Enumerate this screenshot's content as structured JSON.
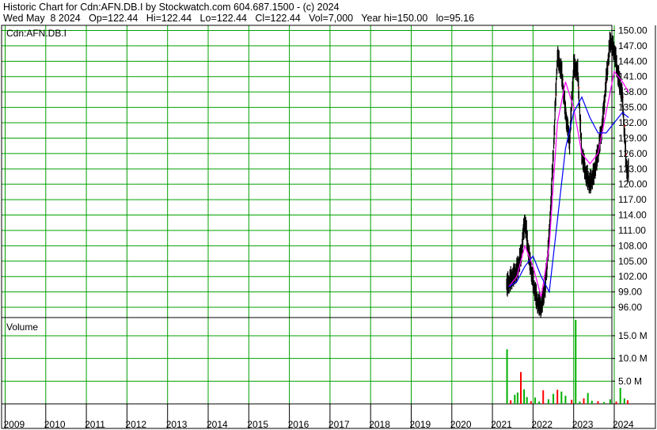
{
  "header": {
    "line1": "Historic Chart for Cdn:AFN.DB.I by Stockwatch.com 604.687.1500 - (c) 2024",
    "line2": "Wed May  8 2024   Op=122.44   Hi=122.44   Lo=122.44   Cl=122.44   Vol=7,000   Year hi=150.00   lo=95.16"
  },
  "price_panel": {
    "symbol_label": "Cdn:AFN.DB.I"
  },
  "volume_panel": {
    "label": "Volume"
  },
  "colors": {
    "grid": "#00a000",
    "price_bar": "#000000",
    "down_mark": "#ff0000",
    "ma_short": "#ff00ff",
    "ma_long": "#0000ff",
    "vol_up": "#00b000",
    "vol_down": "#ff0000"
  },
  "chart_data": [
    {
      "type": "line",
      "title": "Cdn:AFN.DB.I",
      "x_ticks": [
        "2009",
        "2010",
        "2011",
        "2012",
        "2013",
        "2014",
        "2015",
        "2016",
        "2017",
        "2018",
        "2019",
        "2020",
        "2021",
        "2022",
        "2023",
        "2024"
      ],
      "y_ticks": [
        "96.00",
        "99.00",
        "102.00",
        "105.00",
        "108.00",
        "111.00",
        "114.00",
        "117.00",
        "120.00",
        "123.00",
        "126.00",
        "129.00",
        "132.00",
        "135.00",
        "138.00",
        "141.00",
        "144.00",
        "147.00",
        "150.00"
      ],
      "ylim": [
        94,
        151
      ],
      "grid": true,
      "series": [
        {
          "name": "",
          "x": [
            2021.35,
            2021.5,
            2021.6,
            2021.7,
            2021.8,
            2021.9,
            2022.0,
            2022.1,
            2022.2,
            2022.3,
            2022.4,
            2022.5,
            2022.6,
            2022.7,
            2022.8,
            2022.9,
            2023.0,
            2023.1,
            2023.2,
            2023.3,
            2023.4,
            2023.5,
            2023.6,
            2023.7,
            2023.8,
            2023.9,
            2024.0,
            2024.1,
            2024.2,
            2024.3,
            2024.35
          ],
          "y": [
            100,
            102,
            103,
            106,
            113,
            106,
            101,
            97,
            96,
            100,
            110,
            126,
            145,
            142,
            134,
            128,
            143,
            142,
            126,
            122,
            120,
            122,
            126,
            131,
            140,
            148,
            146,
            141,
            137,
            123,
            122.44
          ]
        },
        {
          "name": "",
          "x": [
            2021.4,
            2021.6,
            2021.8,
            2022.0,
            2022.2,
            2022.4,
            2022.6,
            2022.8,
            2023.0,
            2023.2,
            2023.4,
            2023.6,
            2023.8,
            2024.0,
            2024.2,
            2024.35
          ],
          "y": [
            100,
            102,
            108,
            104,
            98,
            108,
            132,
            140,
            135,
            126,
            124,
            126,
            134,
            142,
            140,
            138
          ]
        },
        {
          "name": "",
          "x": [
            2021.4,
            2021.6,
            2021.8,
            2022.0,
            2022.2,
            2022.4,
            2022.6,
            2022.8,
            2023.0,
            2023.2,
            2023.4,
            2023.6,
            2023.8,
            2024.0,
            2024.2,
            2024.35
          ],
          "y": [
            100,
            101,
            104,
            106,
            102,
            99,
            113,
            127,
            134,
            137,
            133,
            130,
            130,
            132,
            134,
            133
          ]
        }
      ]
    },
    {
      "type": "bar",
      "title": "Volume",
      "y_ticks": [
        "5.0 M",
        "10.0 M",
        "15.0 M"
      ],
      "ylim": [
        0,
        19
      ],
      "grid": true,
      "series": [
        {
          "name": "",
          "x": [
            2021.36,
            2021.45,
            2021.55,
            2021.62,
            2021.7,
            2021.78,
            2021.85,
            2021.95,
            2022.05,
            2022.15,
            2022.25,
            2022.38,
            2022.5,
            2022.6,
            2022.7,
            2022.8,
            2022.95,
            2023.05,
            2023.15,
            2023.25,
            2023.35,
            2023.45,
            2023.6,
            2023.75,
            2023.9,
            2024.05,
            2024.15,
            2024.25,
            2024.33
          ],
          "values": [
            12.0,
            0.8,
            2.0,
            2.5,
            7.0,
            3.2,
            1.5,
            0.6,
            1.4,
            0.5,
            3.0,
            1.0,
            2.2,
            3.1,
            2.7,
            1.8,
            0.9,
            18.5,
            0.5,
            1.2,
            2.4,
            0.7,
            0.6,
            0.4,
            1.0,
            0.5,
            3.5,
            1.2,
            0.8
          ]
        }
      ]
    }
  ]
}
